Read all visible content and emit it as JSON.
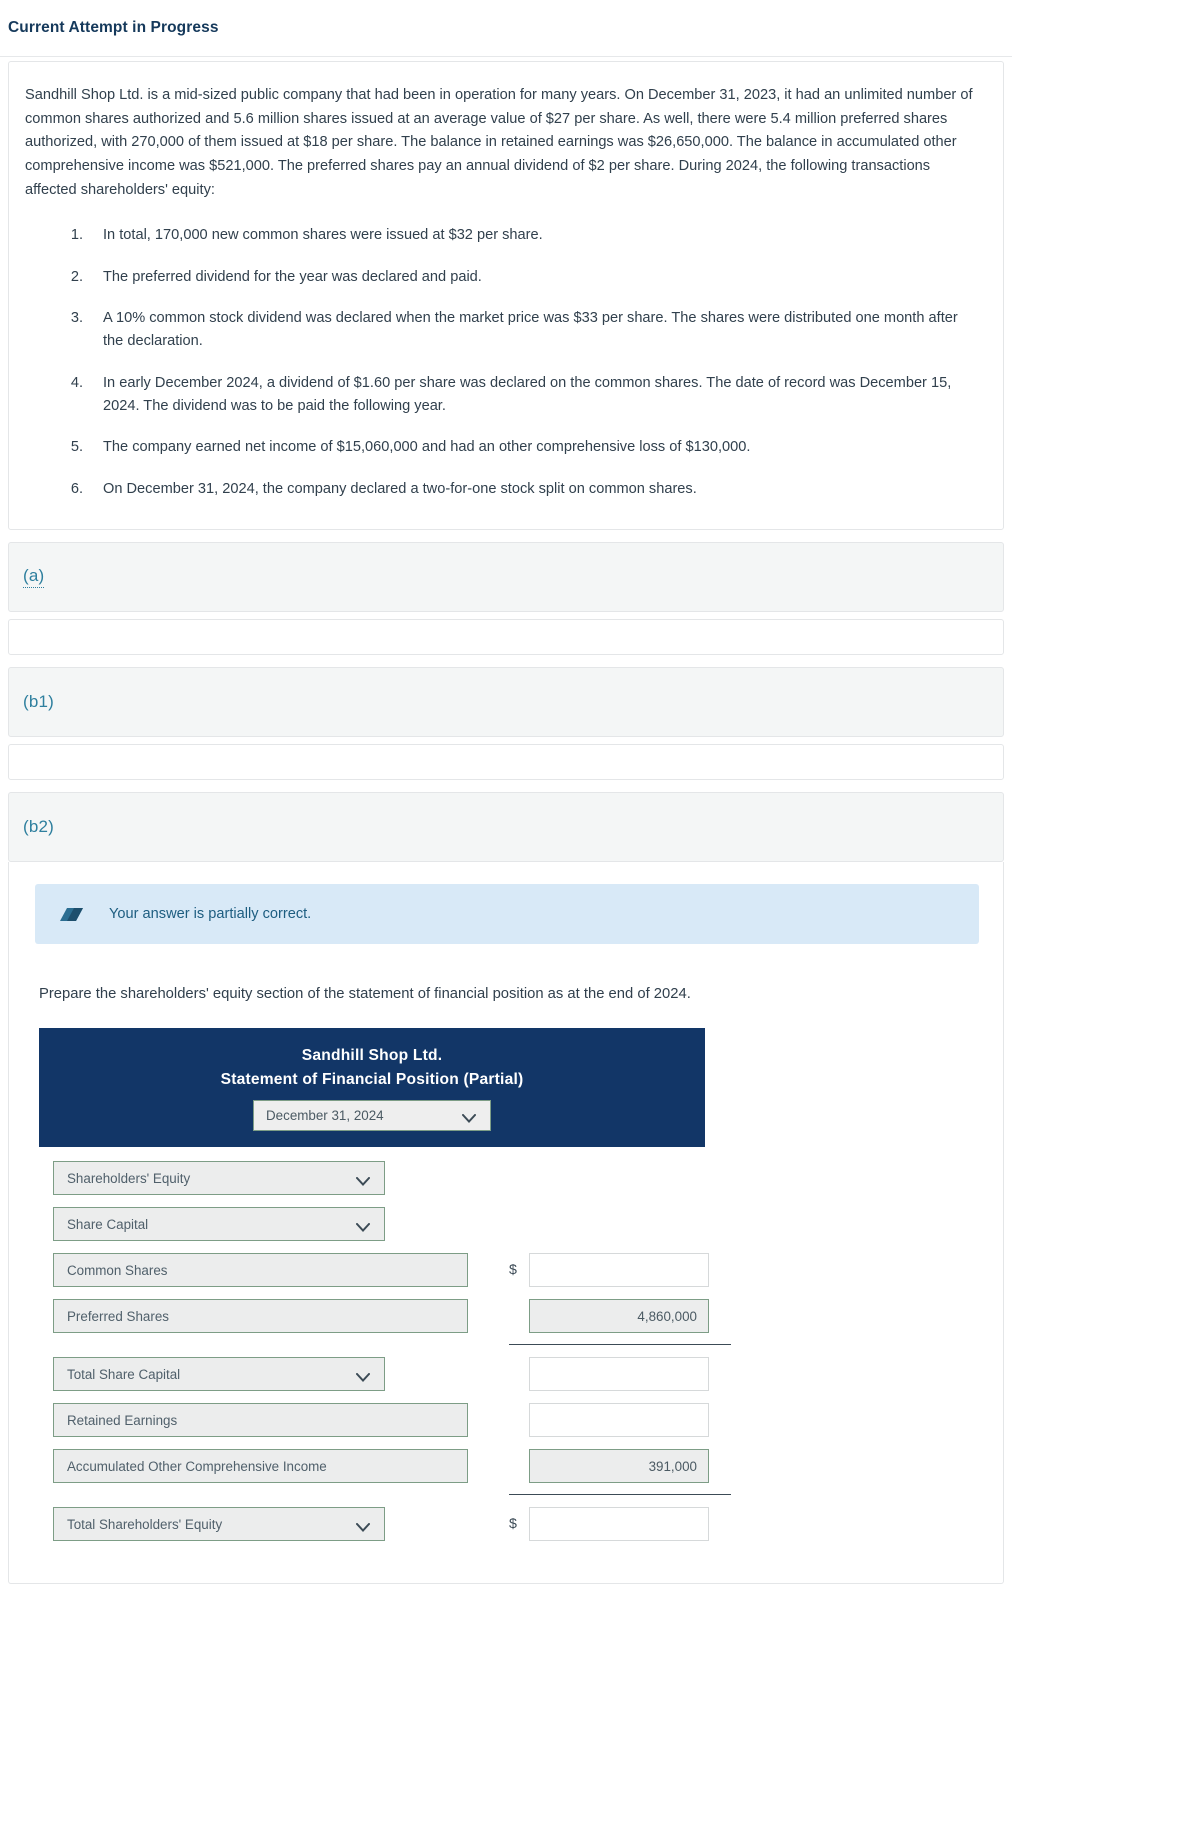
{
  "header": {
    "attempt_title": "Current Attempt in Progress"
  },
  "problem": {
    "intro": "Sandhill Shop Ltd. is a mid-sized public company that had been in operation for many years. On December 31, 2023, it had an unlimited number of common shares authorized and 5.6 million shares issued at an average value of $27 per share. As well, there were 5.4 million preferred shares authorized, with 270,000 of them issued at $18 per share. The balance in retained earnings was $26,650,000. The balance in accumulated other comprehensive income was $521,000. The preferred shares pay an annual dividend of $2 per share. During 2024, the following transactions affected shareholders' equity:",
    "transactions": [
      {
        "num": "1.",
        "text": "In total, 170,000 new common shares were issued at $32 per share."
      },
      {
        "num": "2.",
        "text": "The preferred dividend for the year was declared and paid."
      },
      {
        "num": "3.",
        "text": "A 10% common stock dividend was declared when the market price was $33 per share. The shares were distributed one month after the declaration."
      },
      {
        "num": "4.",
        "text": "In early December 2024, a dividend of $1.60 per share was declared on the common shares. The date of record was December 15, 2024. The dividend was to be paid the following year."
      },
      {
        "num": "5.",
        "text": "The company earned net income of $15,060,000 and had an other comprehensive loss of $130,000."
      },
      {
        "num": "6.",
        "text": "On December 31, 2024, the company declared a two-for-one stock split on common shares."
      }
    ]
  },
  "parts": {
    "a": {
      "label": "(a)"
    },
    "b1": {
      "label": "(b1)"
    },
    "b2": {
      "label": "(b2)",
      "alert_text": "Your answer is partially correct.",
      "alert_icon": "eraser-icon",
      "instruction": "Prepare the shareholders' equity section of the statement of financial position as at the end of 2024."
    }
  },
  "statement": {
    "company": "Sandhill Shop Ltd.",
    "title": "Statement of Financial Position (Partial)",
    "date_value": "December 31, 2024",
    "dollar_symbol": "$",
    "rows": [
      {
        "label": "Shareholders' Equity",
        "kind": "select-narrow",
        "amount": null
      },
      {
        "label": "Share Capital",
        "kind": "select-narrow",
        "amount": null
      },
      {
        "label": "Common Shares",
        "kind": "text-wide",
        "amount": "",
        "dollar": true,
        "amount_filled": false
      },
      {
        "label": "Preferred Shares",
        "kind": "text-wide",
        "amount": "4,860,000",
        "dollar": false,
        "amount_filled": true,
        "rule_after": true
      },
      {
        "label": "Total Share Capital",
        "kind": "select-narrow",
        "amount": "",
        "dollar": false,
        "amount_filled": false
      },
      {
        "label": "Retained Earnings",
        "kind": "text-wide",
        "amount": "",
        "dollar": false,
        "amount_filled": false
      },
      {
        "label": "Accumulated Other Comprehensive Income",
        "kind": "text-wide",
        "amount": "391,000",
        "dollar": false,
        "amount_filled": true,
        "rule_after": true
      },
      {
        "label": "Total Shareholders' Equity",
        "kind": "select-narrow",
        "amount": "",
        "dollar": true,
        "amount_filled": false
      }
    ]
  },
  "colors": {
    "statement_header_bg": "#123667",
    "part_label": "#2e7f9e",
    "alert_bg": "#d8e9f7",
    "field_border_green": "#7d9d86",
    "field_bg_gray": "#eceded"
  }
}
